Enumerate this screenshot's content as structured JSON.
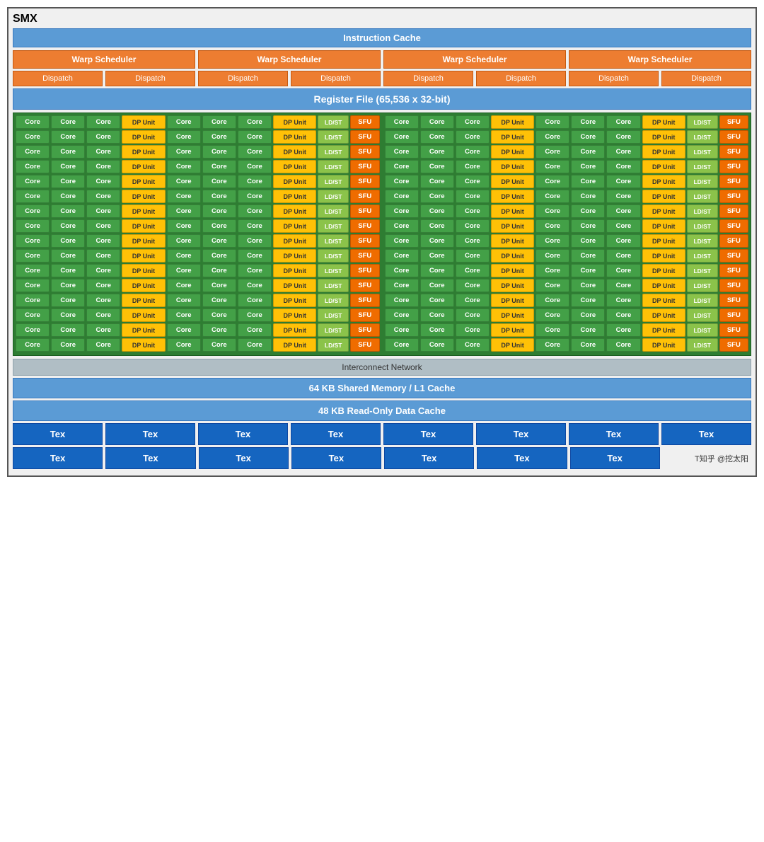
{
  "title": "SMX",
  "instruction_cache": "Instruction Cache",
  "warp_schedulers": [
    "Warp Scheduler",
    "Warp Scheduler",
    "Warp Scheduler",
    "Warp Scheduler"
  ],
  "dispatch_units": [
    "Dispatch",
    "Dispatch",
    "Dispatch",
    "Dispatch",
    "Dispatch",
    "Dispatch",
    "Dispatch",
    "Dispatch"
  ],
  "register_file": "Register File (65,536 x 32-bit)",
  "core_label": "Core",
  "dp_unit_label": "DP Unit",
  "ldst_label": "LD/ST",
  "sfu_label": "SFU",
  "num_rows": 16,
  "interconnect": "Interconnect Network",
  "shared_memory": "64 KB Shared Memory / L1 Cache",
  "readonly_cache": "48 KB Read-Only Data Cache",
  "tex_row1": [
    "Tex",
    "Tex",
    "Tex",
    "Tex",
    "Tex",
    "Tex",
    "Tex",
    "Tex"
  ],
  "tex_row2": [
    "Tex",
    "Tex",
    "Tex",
    "Tex",
    "Tex",
    "Tex",
    "Tex",
    ""
  ],
  "watermark": "T知乎 @挖太阳"
}
